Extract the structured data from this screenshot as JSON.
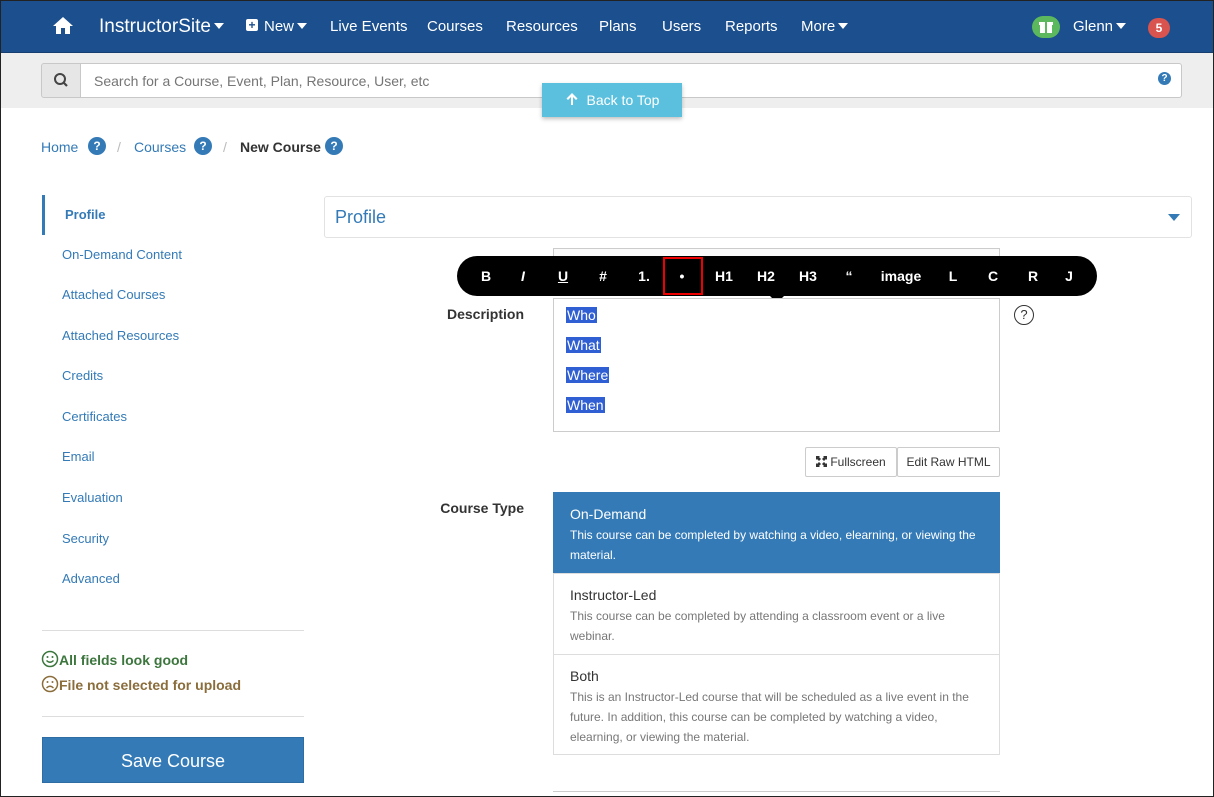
{
  "nav": {
    "brand": "InstructorSite",
    "new_label": "New",
    "items": [
      "Live Events",
      "Courses",
      "Resources",
      "Plans",
      "Users",
      "Reports"
    ],
    "more_label": "More",
    "user_name": "Glenn",
    "notification_count": "5"
  },
  "search": {
    "placeholder": "Search for a Course, Event, Plan, Resource, User, etc"
  },
  "back_to_top": "Back to Top",
  "breadcrumb": {
    "home": "Home",
    "courses": "Courses",
    "current": "New Course",
    "separator": "/",
    "help": "?"
  },
  "sidebar": {
    "items": [
      "Profile",
      "On-Demand Content",
      "Attached Courses",
      "Attached Resources",
      "Credits",
      "Certificates",
      "Email",
      "Evaluation",
      "Security",
      "Advanced"
    ],
    "status_good": "All fields look good",
    "status_bad": "File not selected for upload",
    "save_label": "Save Course"
  },
  "panel": {
    "title": "Profile"
  },
  "editor": {
    "toolbar": [
      "B",
      "I",
      "U",
      "#",
      "1.",
      "•",
      "H1",
      "H2",
      "H3",
      "“",
      "image",
      "L",
      "C",
      "R",
      "J"
    ],
    "description_label": "Description",
    "description_lines": [
      "Who",
      "What",
      "Where",
      "When"
    ],
    "fullscreen_label": "Fullscreen",
    "raw_html_label": "Edit Raw HTML",
    "help": "?"
  },
  "course_type": {
    "label": "Course Type",
    "options": [
      {
        "title": "On-Demand",
        "desc": "This course can be completed by watching a video, elearning, or viewing the material."
      },
      {
        "title": "Instructor-Led",
        "desc": "This course can be completed by attending a classroom event or a live webinar."
      },
      {
        "title": "Both",
        "desc": "This is an Instructor-Led course that will be scheduled as a live event in the future. In addition, this course can be completed by watching a video, elearning, or viewing the material."
      }
    ]
  },
  "colors": {
    "navbar": "#1b4f8d",
    "primary": "#337ab7",
    "info": "#5bc0de",
    "success": "#5cb85c",
    "danger": "#d9534f",
    "highlight": "#e00000"
  }
}
